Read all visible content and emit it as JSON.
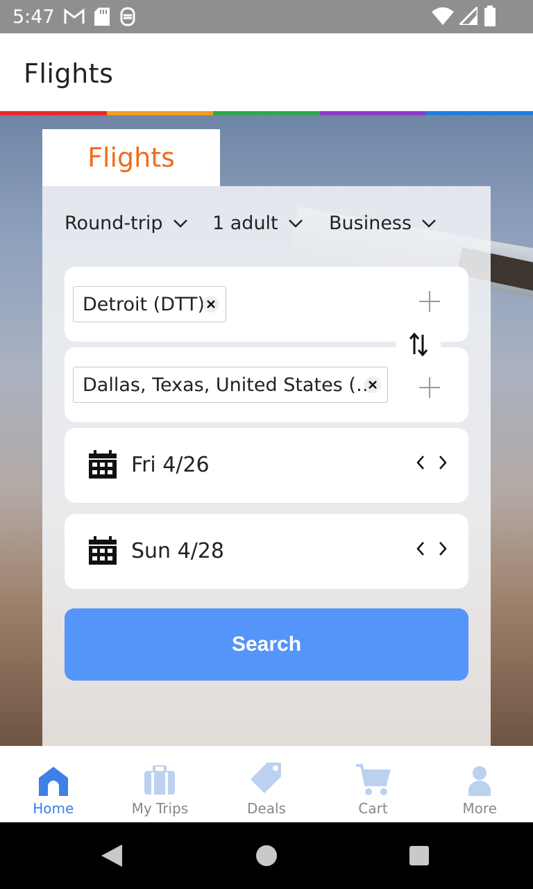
{
  "status_bar": {
    "time": "5:47"
  },
  "app_bar": {
    "title": "Flights"
  },
  "colors": {
    "red": "#e32b2b",
    "orange": "#f39c23",
    "green": "#2ea84f",
    "purple": "#8e3bcc",
    "blue": "#1f7fe0",
    "accent": "#f26b1d",
    "button": "#5594f8"
  },
  "tab": {
    "label": "Flights"
  },
  "options": {
    "trip_type": "Round-trip",
    "travelers": "1 adult",
    "cabin": "Business"
  },
  "origin": {
    "value": "Detroit (DTT)"
  },
  "destination": {
    "value": "Dallas, Texas, United States (…"
  },
  "dates": {
    "depart": "Fri 4/26",
    "return": "Sun 4/28"
  },
  "search_button": {
    "label": "Search"
  },
  "bottom_nav": [
    {
      "label": "Home",
      "icon": "home-icon",
      "active": true
    },
    {
      "label": "My Trips",
      "icon": "briefcase-icon",
      "active": false
    },
    {
      "label": "Deals",
      "icon": "tag-icon",
      "active": false
    },
    {
      "label": "Cart",
      "icon": "cart-icon",
      "active": false
    },
    {
      "label": "More",
      "icon": "person-icon",
      "active": false
    }
  ]
}
